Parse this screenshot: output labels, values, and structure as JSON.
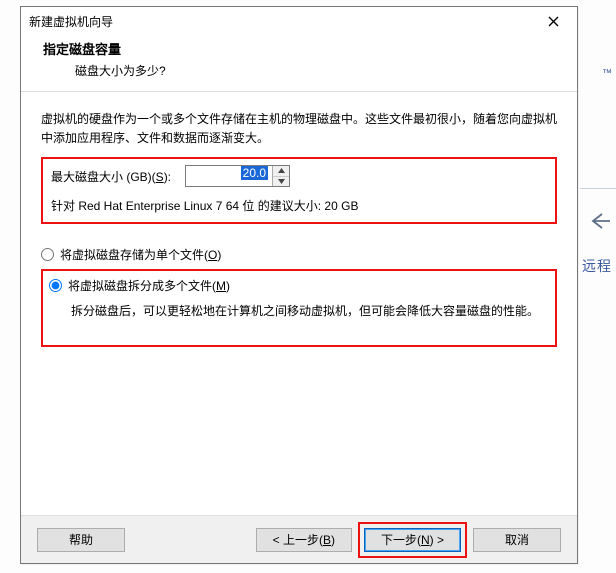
{
  "window": {
    "title": "新建虚拟机向导"
  },
  "header": {
    "title": "指定磁盘容量",
    "subtitle": "磁盘大小为多少?"
  },
  "intro": "虚拟机的硬盘作为一个或多个文件存储在主机的物理磁盘中。这些文件最初很小，随着您向虚拟机中添加应用程序、文件和数据而逐渐变大。",
  "disk": {
    "label_prefix": "最大磁盘大小 (GB)(",
    "label_hotkey": "S",
    "label_suffix": "):",
    "value": "20.0",
    "recommended": "针对 Red Hat Enterprise Linux 7 64 位 的建议大小: 20 GB"
  },
  "radios": {
    "single_prefix": "将虚拟磁盘存储为单个文件(",
    "single_hotkey": "O",
    "single_suffix": ")",
    "split_prefix": "将虚拟磁盘拆分成多个文件(",
    "split_hotkey": "M",
    "split_suffix": ")",
    "split_desc": "拆分磁盘后，可以更轻松地在计算机之间移动虚拟机，但可能会降低大容量磁盘的性能。"
  },
  "footer": {
    "help": "帮助",
    "back_prefix": "< 上一步(",
    "back_hotkey": "B",
    "back_suffix": ")",
    "next_prefix": "下一步(",
    "next_hotkey": "N",
    "next_suffix": ") >",
    "cancel": "取消"
  },
  "bg": {
    "tm": "™",
    "text": "远程"
  }
}
